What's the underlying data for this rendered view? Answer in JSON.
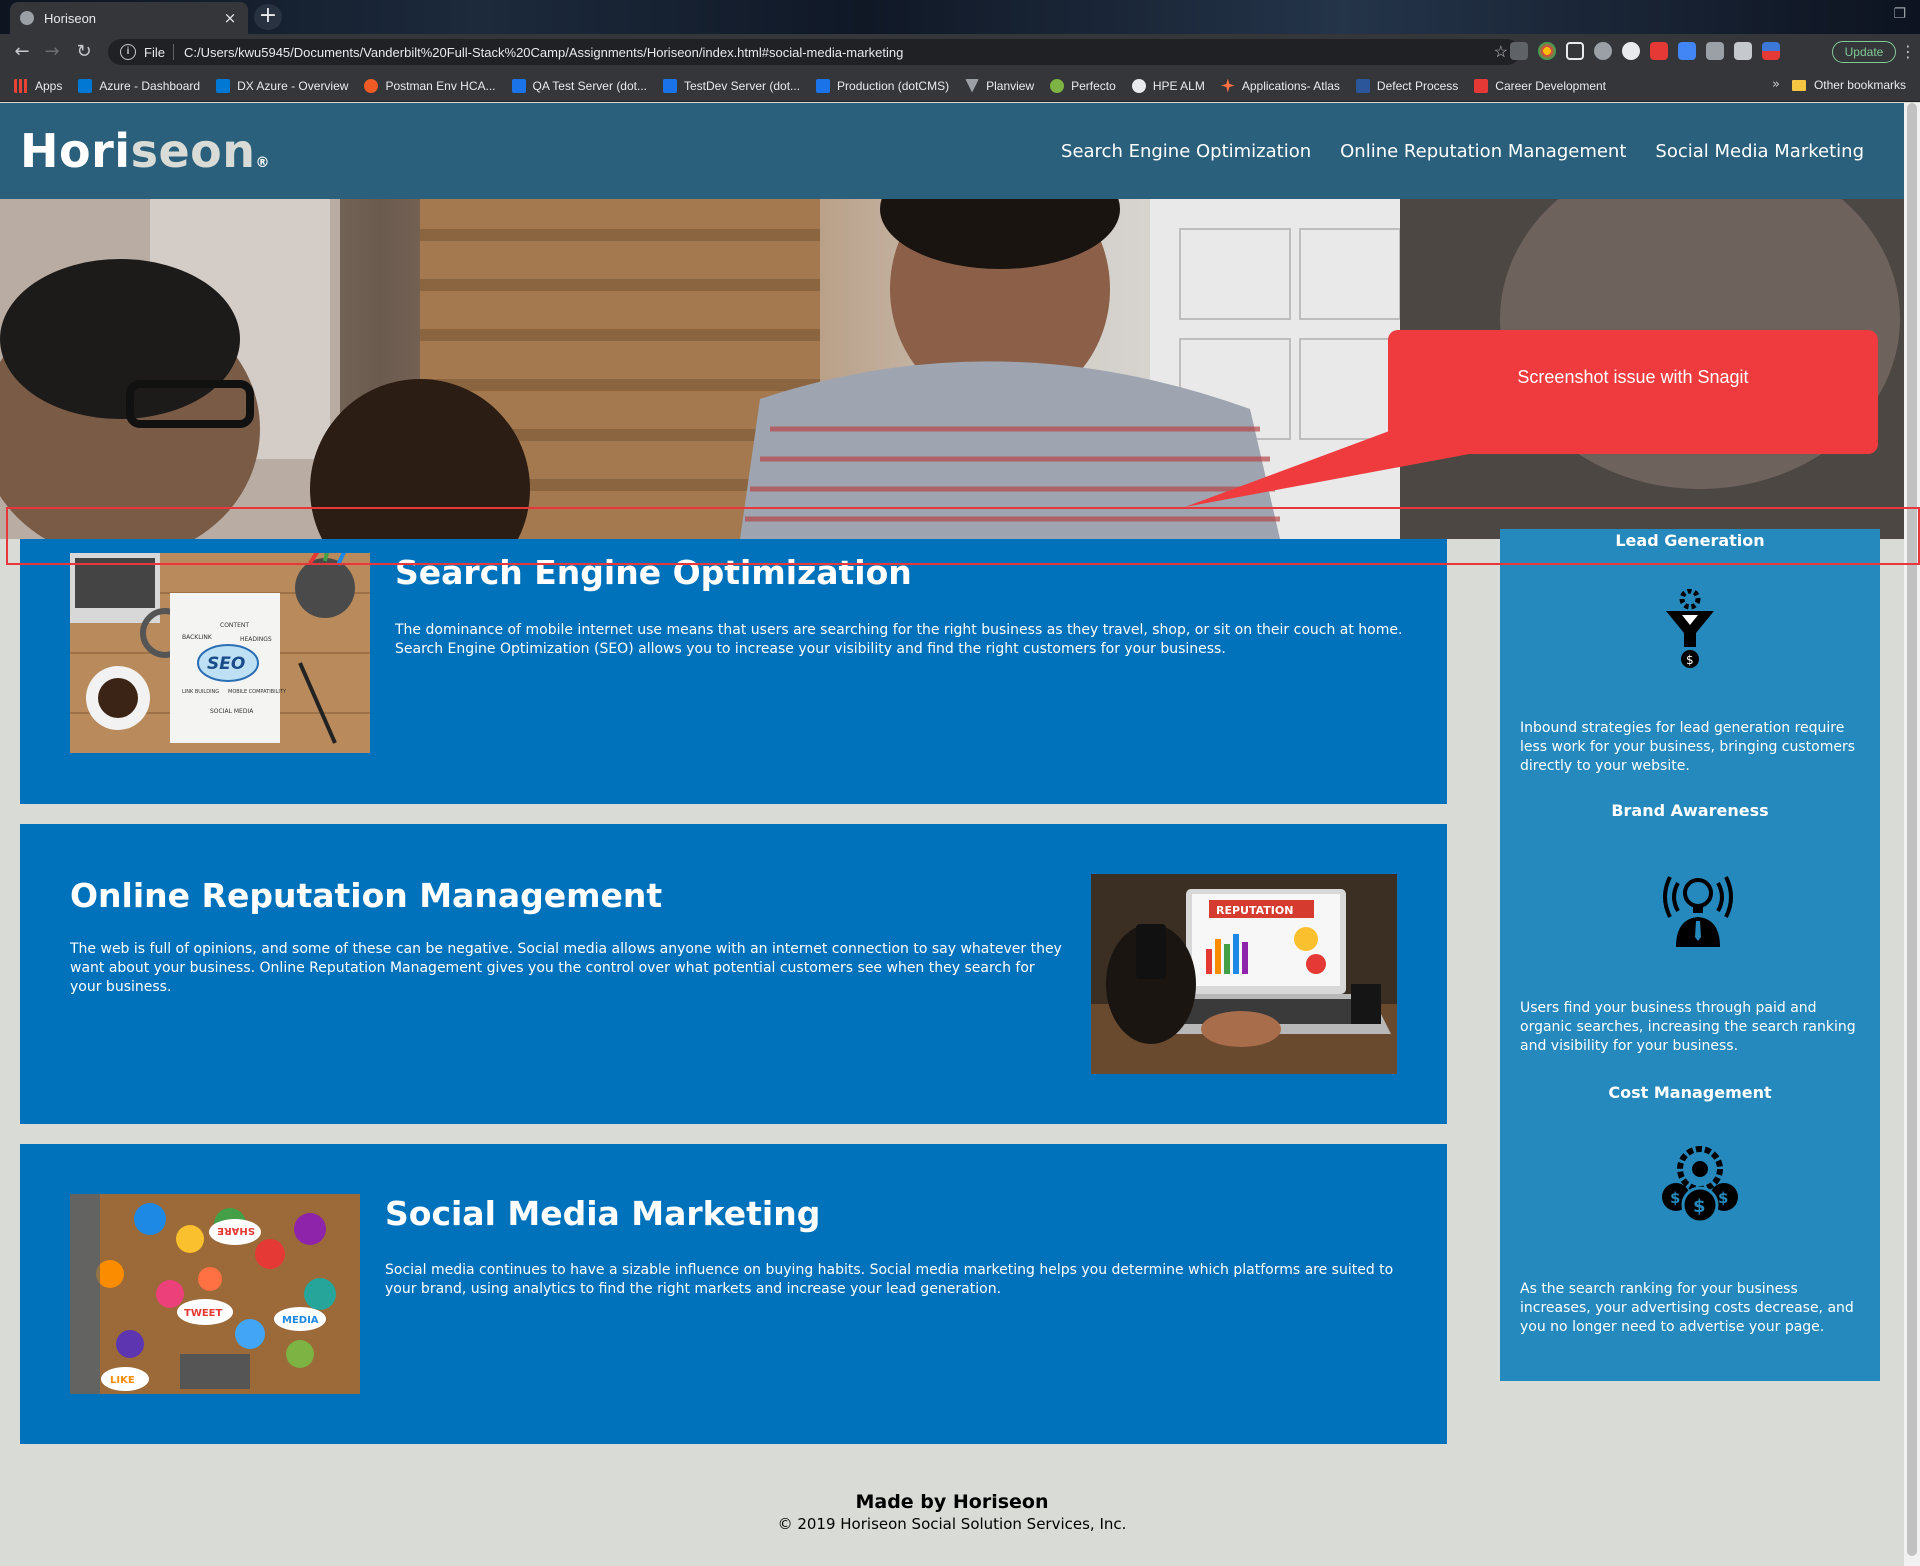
{
  "browser": {
    "tab_title": "Horiseon",
    "tab_close": "×",
    "new_tab": "+",
    "url_scheme": "File",
    "url": "C:/Users/kwu5945/Documents/Vanderbilt%20Full-Stack%20Camp/Assignments/Horiseon/index.html#social-media-marketing",
    "update_label": "Update",
    "bookmarks": [
      {
        "label": "Apps",
        "color": "#ea4335"
      },
      {
        "label": "Azure - Dashboard",
        "color": "#0078d4"
      },
      {
        "label": "DX Azure - Overview",
        "color": "#0078d4"
      },
      {
        "label": "Postman Env HCA...",
        "color": "#ef5b25"
      },
      {
        "label": "QA Test Server (dot...",
        "color": "#1a73e8"
      },
      {
        "label": "TestDev Server (dot...",
        "color": "#1a73e8"
      },
      {
        "label": "Production (dotCMS)",
        "color": "#1a73e8"
      },
      {
        "label": "Planview",
        "color": "#9aa0a6"
      },
      {
        "label": "Perfecto",
        "color": "#7cb342"
      },
      {
        "label": "HPE ALM",
        "color": "#e8eaed"
      },
      {
        "label": "Applications- Atlas",
        "color": "#ff7043"
      },
      {
        "label": "Defect Process",
        "color": "#2b579a"
      },
      {
        "label": "Career Development",
        "color": "#e53935"
      }
    ],
    "bookmarks_overflow": "»",
    "other_bookmarks": "Other bookmarks"
  },
  "site": {
    "logo_main": "Hori",
    "logo_accent": "seon",
    "logo_reg": "®",
    "nav": [
      "Search Engine Optimization",
      "Online Reputation Management",
      "Social Media Marketing"
    ]
  },
  "content": [
    {
      "title": "Search Engine Optimization",
      "text": "The dominance of mobile internet use means that users are searching for the right business as they travel, shop, or sit on their couch at home. Search Engine Optimization (SEO) allows you to increase your visibility and find the right customers for your business."
    },
    {
      "title": "Online Reputation Management",
      "text": "The web is full of opinions, and some of these can be negative. Social media allows anyone with an internet connection to say whatever they want about your business. Online Reputation Management gives you the control over what potential customers see when they search for your business."
    },
    {
      "title": "Social Media Marketing",
      "text": "Social media continues to have a sizable influence on buying habits. Social media marketing helps you determine which platforms are suited to your brand, using analytics to find the right markets and increase your lead generation."
    }
  ],
  "images": {
    "seo_words": [
      "SEO",
      "BACKLINK",
      "CONTENT",
      "HEADINGS",
      "LINK BUILDING",
      "MOBILE COMPATIBILITY",
      "SOCIAL MEDIA"
    ],
    "reputation_word": "REPUTATION",
    "social_words": [
      "SHARE",
      "TWEET",
      "LIKE",
      "MEDIA"
    ]
  },
  "benefits": [
    {
      "title": "Lead Generation",
      "text": "Inbound strategies for lead generation require less work for your business, bringing customers directly to your website.",
      "icon": "lead-generation-icon"
    },
    {
      "title": "Brand Awareness",
      "text": "Users find your business through paid and organic searches, increasing the search ranking and visibility for your business.",
      "icon": "brand-awareness-icon"
    },
    {
      "title": "Cost Management",
      "text": "As the search ranking for your business increases, your advertising costs decrease, and you no longer need to advertise your page.",
      "icon": "cost-management-icon"
    }
  ],
  "footer": {
    "made_by": "Made by Horiseon",
    "copyright": "© 2019 Horiseon Social Solution Services, Inc."
  },
  "annotation": {
    "callout_text": "Screenshot issue with Snagit"
  },
  "colors": {
    "header": "#2a607c",
    "card": "#0072bb",
    "sidebar": "#2589bd",
    "page_bg": "#d9dcd6",
    "annotation": "#ef3b3d"
  }
}
